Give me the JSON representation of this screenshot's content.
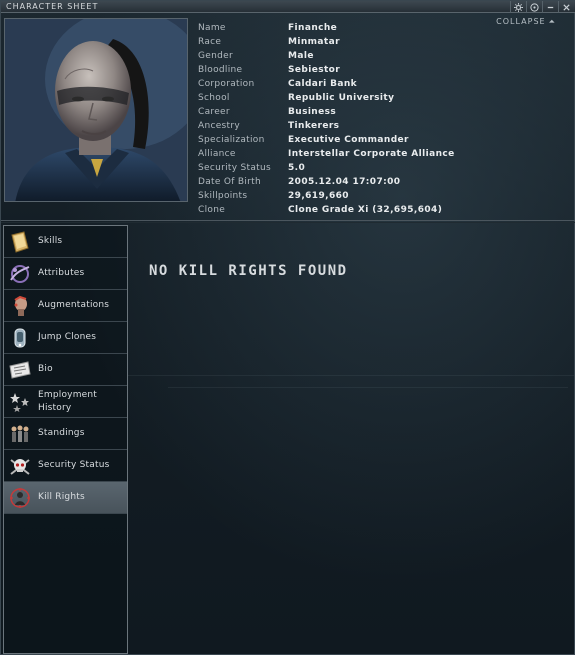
{
  "window": {
    "title": "CHARACTER SHEET",
    "collapse_label": "COLLAPSE"
  },
  "window_buttons": [
    {
      "icon": "settings-icon"
    },
    {
      "icon": "info-icon"
    },
    {
      "icon": "minimize-icon"
    },
    {
      "icon": "close-icon"
    }
  ],
  "character": {
    "fields": [
      {
        "label": "Name",
        "value": "Finanche"
      },
      {
        "label": "Race",
        "value": "Minmatar"
      },
      {
        "label": "Gender",
        "value": "Male"
      },
      {
        "label": "Bloodline",
        "value": "Sebiestor"
      },
      {
        "label": "Corporation",
        "value": "Caldari Bank"
      },
      {
        "label": "School",
        "value": "Republic University"
      },
      {
        "label": "Career",
        "value": "Business"
      },
      {
        "label": "Ancestry",
        "value": "Tinkerers"
      },
      {
        "label": "Specialization",
        "value": "Executive Commander"
      },
      {
        "label": "Alliance",
        "value": "Interstellar Corporate Alliance"
      },
      {
        "label": "Security Status",
        "value": "5.0"
      },
      {
        "label": "Date Of Birth",
        "value": "2005.12.04 17:07:00"
      },
      {
        "label": "Skillpoints",
        "value": "29,619,660"
      },
      {
        "label": "Clone",
        "value": "Clone Grade Xi (32,695,604)"
      }
    ]
  },
  "sidebar": {
    "items": [
      {
        "label": "Skills",
        "icon": "book-icon",
        "selected": false
      },
      {
        "label": "Attributes",
        "icon": "attributes-icon",
        "selected": false
      },
      {
        "label": "Augmentations",
        "icon": "implant-head-icon",
        "selected": false
      },
      {
        "label": "Jump Clones",
        "icon": "clone-pod-icon",
        "selected": false
      },
      {
        "label": "Bio",
        "icon": "document-icon",
        "selected": false
      },
      {
        "label": "Employment\nHistory",
        "icon": "stars-icon",
        "selected": false
      },
      {
        "label": "Standings",
        "icon": "people-icon",
        "selected": false
      },
      {
        "label": "Security Status",
        "icon": "skull-icon",
        "selected": false
      },
      {
        "label": "Kill Rights",
        "icon": "target-person-icon",
        "selected": true
      }
    ]
  },
  "main": {
    "message": "NO KILL RIGHTS FOUND"
  },
  "colors": {
    "background": "#141e25",
    "selected": "#525e67",
    "text": "#c9ced2",
    "border": "#6b757c"
  }
}
